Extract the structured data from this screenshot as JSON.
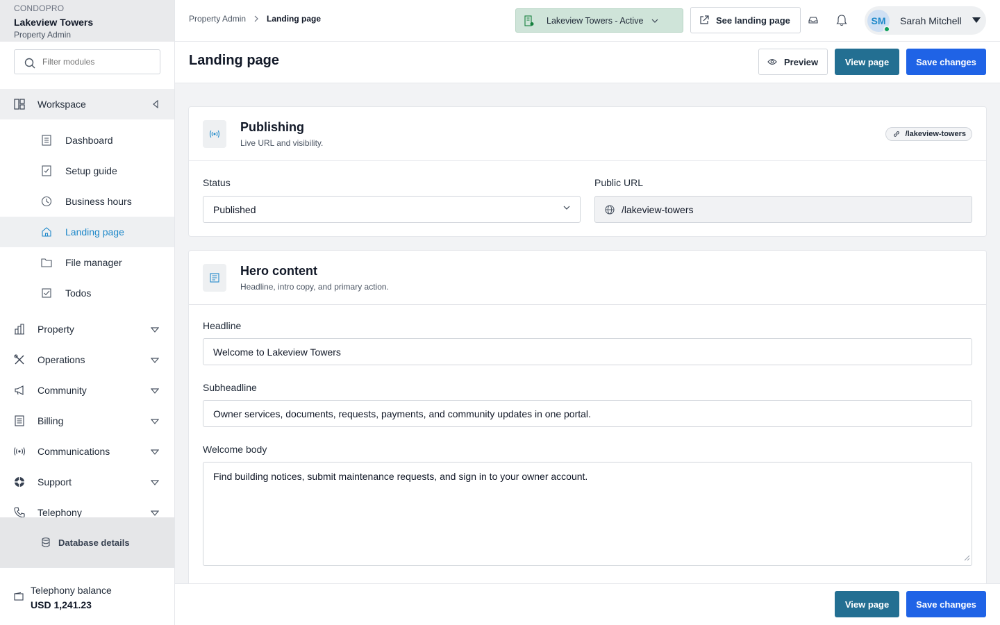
{
  "brand": {
    "org": "CONDOPRO",
    "name": "Lakeview Towers",
    "role": "Property Admin"
  },
  "sidebar": {
    "filter_placeholder": "Filter modules",
    "workspace_label": "Workspace",
    "workspace_items": [
      {
        "label": "Dashboard",
        "icon": "dashboard-icon"
      },
      {
        "label": "Setup guide",
        "icon": "checklist-icon"
      },
      {
        "label": "Business hours",
        "icon": "clock-icon"
      },
      {
        "label": "Landing page",
        "icon": "home-icon",
        "active": true
      },
      {
        "label": "File manager",
        "icon": "folder-icon"
      },
      {
        "label": "Todos",
        "icon": "checkbox-icon"
      }
    ],
    "groups": [
      {
        "label": "Property",
        "icon": "building-icon"
      },
      {
        "label": "Operations",
        "icon": "tools-icon"
      },
      {
        "label": "Community",
        "icon": "megaphone-icon"
      },
      {
        "label": "Billing",
        "icon": "receipt-icon"
      },
      {
        "label": "Communications",
        "icon": "broadcast-icon"
      },
      {
        "label": "Support",
        "icon": "lifebuoy-icon"
      },
      {
        "label": "Telephony",
        "icon": "phone-icon"
      }
    ],
    "database_label": "Database details",
    "balance_label": "Telephony balance",
    "balance_value": "USD 1,241.23"
  },
  "topbar": {
    "breadcrumb_root": "Property Admin",
    "breadcrumb_current": "Landing page",
    "property_selector": "Lakeview Towers - Active",
    "see_landing_label": "See landing page",
    "user_initials": "SM",
    "user_name": "Sarah Mitchell"
  },
  "page": {
    "title": "Landing page",
    "preview_label": "Preview",
    "view_label": "View page",
    "save_label": "Save changes"
  },
  "publishing": {
    "title": "Publishing",
    "subtitle": "Live URL and visibility.",
    "url_chip": "/lakeview-towers",
    "status_label": "Status",
    "status_value": "Published",
    "public_url_label": "Public URL",
    "public_url_value": "/lakeview-towers"
  },
  "hero": {
    "title": "Hero content",
    "subtitle": "Headline, intro copy, and primary action.",
    "headline_label": "Headline",
    "headline_value": "Welcome to Lakeview Towers",
    "subheadline_label": "Subheadline",
    "subheadline_value": "Owner services, documents, requests, payments, and community updates in one portal.",
    "body_label": "Welcome body",
    "body_value": "Find building notices, submit maintenance requests, and sign in to your owner account."
  },
  "footer": {
    "view_label": "View page",
    "save_label": "Save changes"
  },
  "colors": {
    "accent": "#1e88c9",
    "primary_button": "#1f63e6",
    "secondary_button": "#236f92",
    "status_green": "#10a05a"
  }
}
